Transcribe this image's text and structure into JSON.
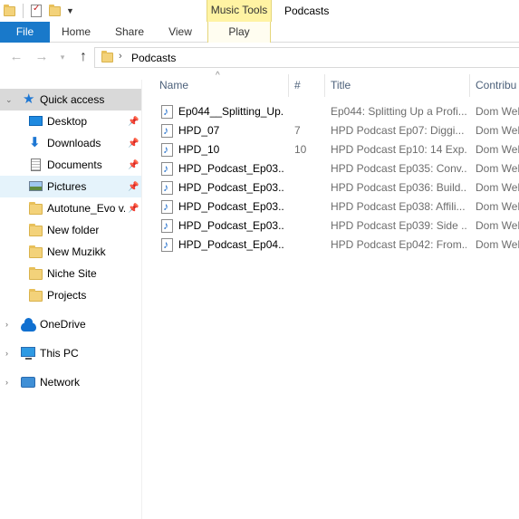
{
  "titlebar": {
    "contextual_tab_group": "Music Tools",
    "window_title": "Podcasts"
  },
  "ribbon": {
    "tabs": [
      "File",
      "Home",
      "Share",
      "View",
      "Play"
    ]
  },
  "address": {
    "path": "Podcasts"
  },
  "navpane": {
    "quick_access": "Quick access",
    "items": [
      {
        "label": "Desktop",
        "icon": "desktop-icon",
        "pinned": true
      },
      {
        "label": "Downloads",
        "icon": "download-icon",
        "pinned": true
      },
      {
        "label": "Documents",
        "icon": "documents-icon",
        "pinned": true
      },
      {
        "label": "Pictures",
        "icon": "pictures-icon",
        "pinned": true
      },
      {
        "label": "Autotune_Evo v.",
        "icon": "folder-icon",
        "pinned": true
      },
      {
        "label": "New folder",
        "icon": "folder-icon",
        "pinned": false
      },
      {
        "label": "New Muzikk",
        "icon": "folder-icon",
        "pinned": false
      },
      {
        "label": "Niche Site",
        "icon": "folder-icon",
        "pinned": false
      },
      {
        "label": "Projects",
        "icon": "folder-icon",
        "pinned": false
      }
    ],
    "onedrive": "OneDrive",
    "this_pc": "This PC",
    "network": "Network"
  },
  "columns": {
    "name": "Name",
    "number": "#",
    "title": "Title",
    "contributing": "Contribu"
  },
  "files": [
    {
      "name": "Ep044__Splitting_Up...",
      "number": "",
      "title": "Ep044: Splitting Up a Profi...",
      "contrib": "Dom Wel"
    },
    {
      "name": "HPD_07",
      "number": "7",
      "title": "HPD Podcast Ep07: Diggi...",
      "contrib": "Dom Wel"
    },
    {
      "name": "HPD_10",
      "number": "10",
      "title": "HPD Podcast Ep10: 14 Exp...",
      "contrib": "Dom Wel"
    },
    {
      "name": "HPD_Podcast_Ep03...",
      "number": "",
      "title": "HPD Podcast Ep035: Conv...",
      "contrib": "Dom Wel"
    },
    {
      "name": "HPD_Podcast_Ep03...",
      "number": "",
      "title": "HPD Podcast Ep036: Build...",
      "contrib": "Dom Wel"
    },
    {
      "name": "HPD_Podcast_Ep03...",
      "number": "",
      "title": "HPD Podcast Ep038: Affili...",
      "contrib": "Dom Wel"
    },
    {
      "name": "HPD_Podcast_Ep03...",
      "number": "",
      "title": "HPD Podcast Ep039: Side ...",
      "contrib": "Dom Wel"
    },
    {
      "name": "HPD_Podcast_Ep04...",
      "number": "",
      "title": "HPD Podcast Ep042: From...",
      "contrib": "Dom Wel"
    }
  ],
  "colors": {
    "file_tab": "#1979ca",
    "music_tools": "#fff3a3",
    "selected_nav": "#d9d9d9",
    "hover_nav": "#e5f3fb",
    "header_text": "#4c607a"
  }
}
